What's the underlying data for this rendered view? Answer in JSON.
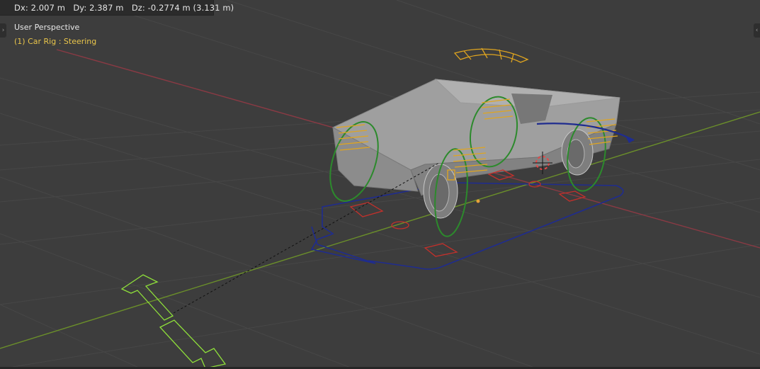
{
  "header": {
    "delta_readout": "Dx: 2.007 m   Dy: 2.387 m   Dz: -0.2774 m (3.131 m)"
  },
  "viewport": {
    "view_name": "User Perspective",
    "active_object": "(1) Car Rig : Steering"
  },
  "icons": {
    "left_toggle": "chevron-right-icon",
    "right_toggle": "chevron-left-icon",
    "cursor": "3d-cursor-icon"
  },
  "colors": {
    "background": "#3d3d3d",
    "grid": "#4a4a4a",
    "x_axis": "#8a3a44",
    "y_axis": "#6b8f2a",
    "rig_yellow": "#e0a51f",
    "rig_green": "#2c8a2c",
    "rig_blue": "#1f2c8f",
    "rig_red": "#c4302b",
    "active_arrow": "#8fe03a",
    "car_body": "#9a9a9a"
  }
}
